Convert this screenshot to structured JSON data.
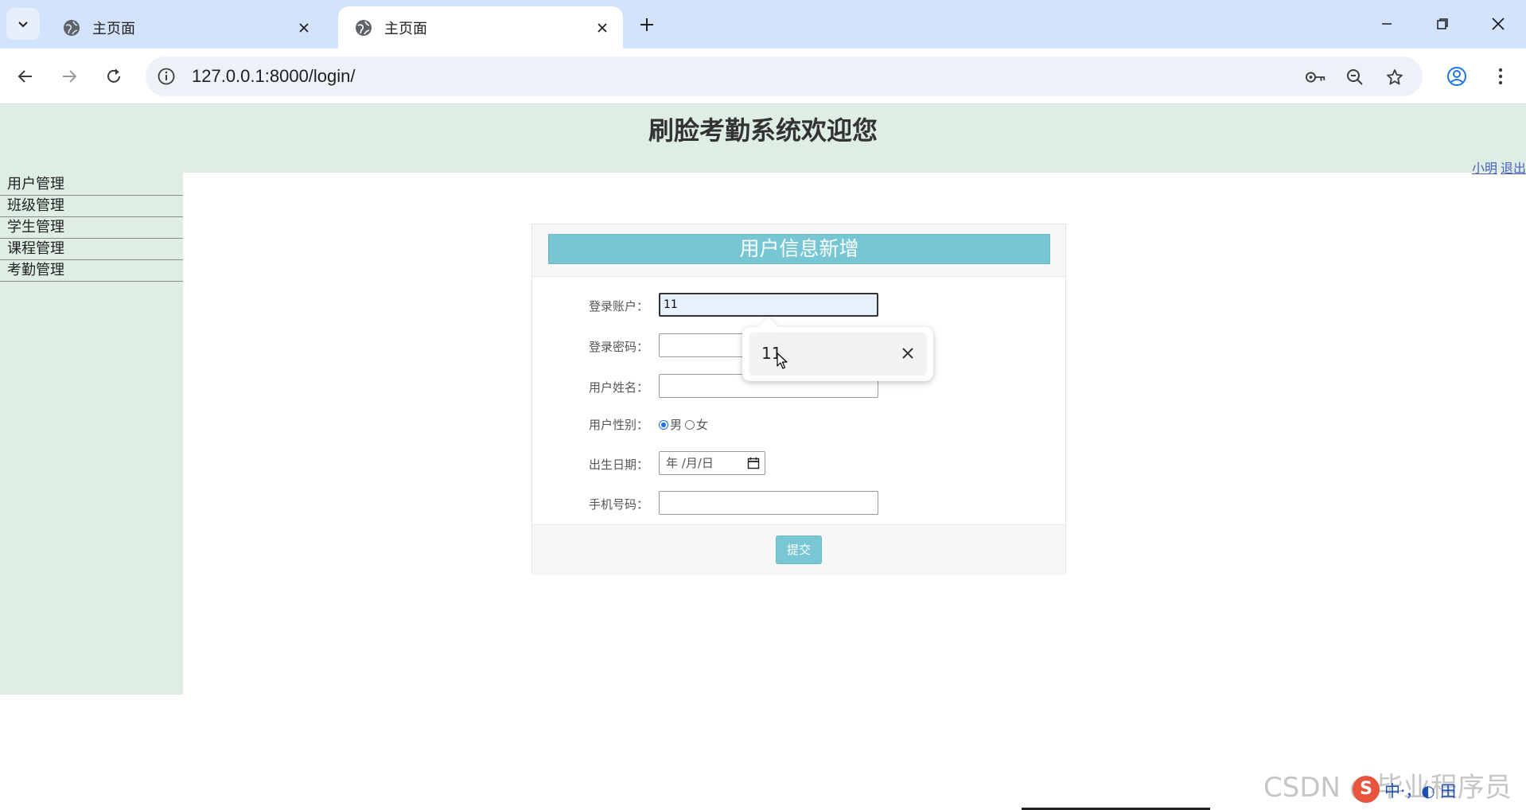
{
  "browser": {
    "tabs": [
      {
        "title": "主页面",
        "active": false
      },
      {
        "title": "主页面",
        "active": true
      }
    ],
    "url": "127.0.0.1:8000/login/"
  },
  "header": {
    "title": "刷脸考勤系统欢迎您",
    "user_name": "小明",
    "logout": "退出"
  },
  "sidebar": {
    "items": [
      {
        "label": "用户管理"
      },
      {
        "label": "班级管理"
      },
      {
        "label": "学生管理"
      },
      {
        "label": "课程管理"
      },
      {
        "label": "考勤管理"
      }
    ]
  },
  "form": {
    "title": "用户信息新增",
    "account_label": "登录账户：",
    "account_value": "11",
    "password_label": "登录密码：",
    "password_value": "",
    "name_label": "用户姓名：",
    "name_value": "",
    "gender_label": "用户性别：",
    "gender_male": "男",
    "gender_female": "女",
    "gender_selected": "男",
    "birth_label": "出生日期：",
    "birth_placeholder": "年 /月/日",
    "phone_label": "手机号码：",
    "phone_value": "",
    "submit": "提交"
  },
  "autofill": {
    "suggestion": "11"
  },
  "watermark": "CSDN @毕业程序员",
  "ime": {
    "logo": "S",
    "text": "中·，◐ 田"
  },
  "colors": {
    "tabstrip": "#d3e3fd",
    "page_bg": "#dfeee5",
    "accent": "#76c6d3"
  }
}
